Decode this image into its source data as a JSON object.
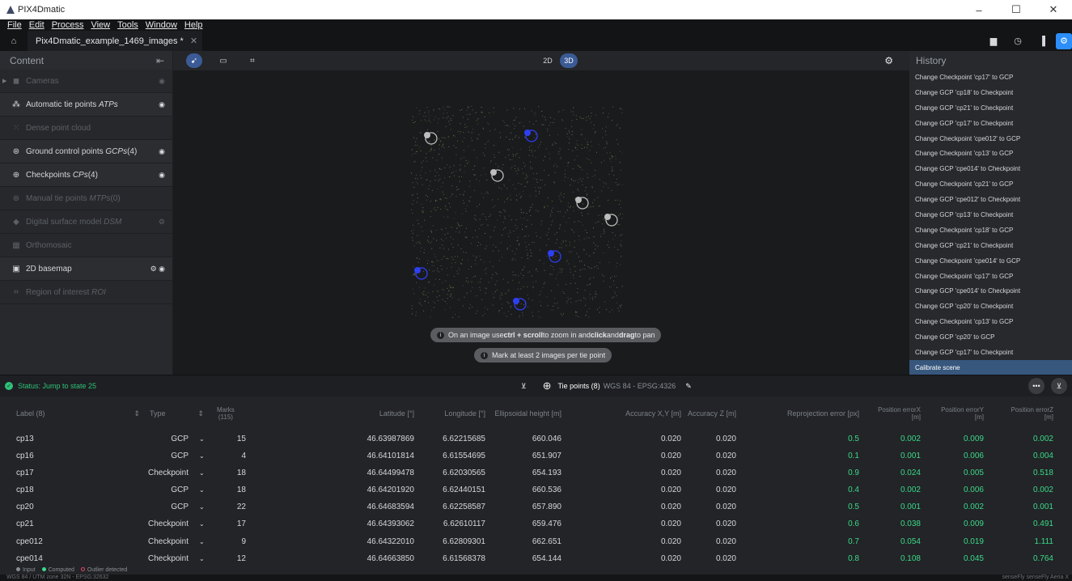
{
  "window": {
    "title": "PIX4Dmatic",
    "controls": [
      "–",
      "☐",
      "✕"
    ]
  },
  "menu": [
    "File",
    "Edit",
    "Process",
    "View",
    "Tools",
    "Window",
    "Help"
  ],
  "project_tab": {
    "label": "Pix4Dmatic_example_1469_images *",
    "close": "✕"
  },
  "content_panel": {
    "title": "Content",
    "layers": [
      {
        "icon": "camera-icon",
        "label": "Cameras",
        "dim": true,
        "right": "◉"
      },
      {
        "icon": "tie-points-icon",
        "label": "Automatic tie points",
        "italic": "ATPs",
        "dim": false,
        "right": "◉"
      },
      {
        "icon": "dense-cloud-icon",
        "label": "Dense point cloud",
        "dim": true,
        "right": ""
      },
      {
        "icon": "gcp-icon",
        "label": "Ground control points",
        "italic": "GCPs",
        "suffix": " (4)",
        "dim": false,
        "right": "◉"
      },
      {
        "icon": "checkpoint-icon",
        "label": "Checkpoints",
        "italic": "CPs",
        "suffix": " (4)",
        "dim": false,
        "right": "◉"
      },
      {
        "icon": "mtp-icon",
        "label": "Manual tie points",
        "italic": "MTPs",
        "suffix": " (0)",
        "dim": true,
        "right": ""
      },
      {
        "icon": "dsm-icon",
        "label": "Digital surface model",
        "italic": "DSM",
        "dim": true,
        "right": "⚙"
      },
      {
        "icon": "ortho-icon",
        "label": "Orthomosaic",
        "dim": true,
        "right": ""
      },
      {
        "icon": "basemap-icon",
        "label": "2D basemap",
        "dim": false,
        "right": "⚙ ◉"
      },
      {
        "icon": "roi-icon",
        "label": "Region of interest",
        "italic": "ROI",
        "dim": true,
        "right": ""
      }
    ]
  },
  "viewport": {
    "modes": [
      "2D",
      "3D"
    ],
    "active_mode": "3D",
    "hint1": {
      "pre": "On an image use ",
      "b1": "ctrl + scroll",
      "mid": " to zoom in and ",
      "b2": "click",
      "mid2": " and ",
      "b3": "drag",
      "post": " to pan"
    },
    "hint2": "Mark at least 2 images per tie point"
  },
  "history": {
    "title": "History",
    "items": [
      "Change Checkpoint 'cp17' to GCP",
      "Change GCP 'cp18' to Checkpoint",
      "Change GCP 'cp21' to Checkpoint",
      "Change GCP 'cp17' to Checkpoint",
      "Change Checkpoint 'cpe012' to GCP",
      "Change Checkpoint 'cp13' to GCP",
      "Change GCP 'cpe014' to Checkpoint",
      "Change Checkpoint 'cp21' to GCP",
      "Change GCP 'cpe012' to Checkpoint",
      "Change GCP 'cp13' to Checkpoint",
      "Change Checkpoint 'cp18' to GCP",
      "Change GCP 'cp21' to Checkpoint",
      "Change Checkpoint 'cpe014' to GCP",
      "Change Checkpoint 'cp17' to GCP",
      "Change GCP 'cpe014' to Checkpoint",
      "Change GCP 'cp20' to Checkpoint",
      "Change Checkpoint 'cp13' to GCP",
      "Change GCP 'cp20' to GCP",
      "Change GCP 'cp17' to Checkpoint",
      "Calibrate scene"
    ]
  },
  "status": {
    "text": "Status: Jump to state 25"
  },
  "tie_points": {
    "label": "Tie points (8)",
    "crs": "WGS 84 - EPSG:4326"
  },
  "table": {
    "headers": {
      "label": "Label (8)",
      "type": "Type",
      "marks": "Marks",
      "marks_count": "(115)",
      "lat": "Latitude [°]",
      "lon": "Longitude [°]",
      "height": "Ellipsoidal height [m]",
      "accxy": "Accuracy X,Y [m]",
      "accz": "Accuracy Z [m]",
      "reproj": "Reprojection error [px]",
      "posx": "Position errorX [m]",
      "posy": "Position errorY [m]",
      "posz": "Position errorZ [m]"
    },
    "rows": [
      {
        "label": "cp13",
        "type": "GCP",
        "marks": "15",
        "lat": "46.63987869",
        "lon": "6.62215685",
        "height": "660.046",
        "accxy": "0.020",
        "accz": "0.020",
        "reproj": "0.5",
        "posx": "0.002",
        "posy": "0.009",
        "posz": "0.002"
      },
      {
        "label": "cp16",
        "type": "GCP",
        "marks": "4",
        "lat": "46.64101814",
        "lon": "6.61554695",
        "height": "651.907",
        "accxy": "0.020",
        "accz": "0.020",
        "reproj": "0.1",
        "posx": "0.001",
        "posy": "0.006",
        "posz": "0.004"
      },
      {
        "label": "cp17",
        "type": "Checkpoint",
        "marks": "18",
        "lat": "46.64499478",
        "lon": "6.62030565",
        "height": "654.193",
        "accxy": "0.020",
        "accz": "0.020",
        "reproj": "0.9",
        "posx": "0.024",
        "posy": "0.005",
        "posz": "0.518"
      },
      {
        "label": "cp18",
        "type": "GCP",
        "marks": "18",
        "lat": "46.64201920",
        "lon": "6.62440151",
        "height": "660.536",
        "accxy": "0.020",
        "accz": "0.020",
        "reproj": "0.4",
        "posx": "0.002",
        "posy": "0.006",
        "posz": "0.002"
      },
      {
        "label": "cp20",
        "type": "GCP",
        "marks": "22",
        "lat": "46.64683594",
        "lon": "6.62258587",
        "height": "657.890",
        "accxy": "0.020",
        "accz": "0.020",
        "reproj": "0.5",
        "posx": "0.001",
        "posy": "0.002",
        "posz": "0.001"
      },
      {
        "label": "cp21",
        "type": "Checkpoint",
        "marks": "17",
        "lat": "46.64393062",
        "lon": "6.62610117",
        "height": "659.476",
        "accxy": "0.020",
        "accz": "0.020",
        "reproj": "0.6",
        "posx": "0.038",
        "posy": "0.009",
        "posz": "0.491"
      },
      {
        "label": "cpe012",
        "type": "Checkpoint",
        "marks": "9",
        "lat": "46.64322010",
        "lon": "6.62809301",
        "height": "662.651",
        "accxy": "0.020",
        "accz": "0.020",
        "reproj": "0.7",
        "posx": "0.054",
        "posy": "0.019",
        "posz": "1.111"
      },
      {
        "label": "cpe014",
        "type": "Checkpoint",
        "marks": "12",
        "lat": "46.64663850",
        "lon": "6.61568378",
        "height": "654.144",
        "accxy": "0.020",
        "accz": "0.020",
        "reproj": "0.8",
        "posx": "0.108",
        "posy": "0.045",
        "posz": "0.764"
      }
    ]
  },
  "legend": {
    "input": "Input",
    "computed": "Computed",
    "outlier": "Outlier detected"
  },
  "footer": {
    "left": "WGS 84 / UTM zone 32N - EPSG:32632",
    "right": "senseFly senseFly Aeria X"
  },
  "colors": {
    "accent": "#2c8ef8",
    "status_ok": "#2fc178",
    "value_green": "#3cd98a",
    "gcp_blue": "#2f3ff2",
    "checkpoint_gray": "#bdbdbd"
  }
}
